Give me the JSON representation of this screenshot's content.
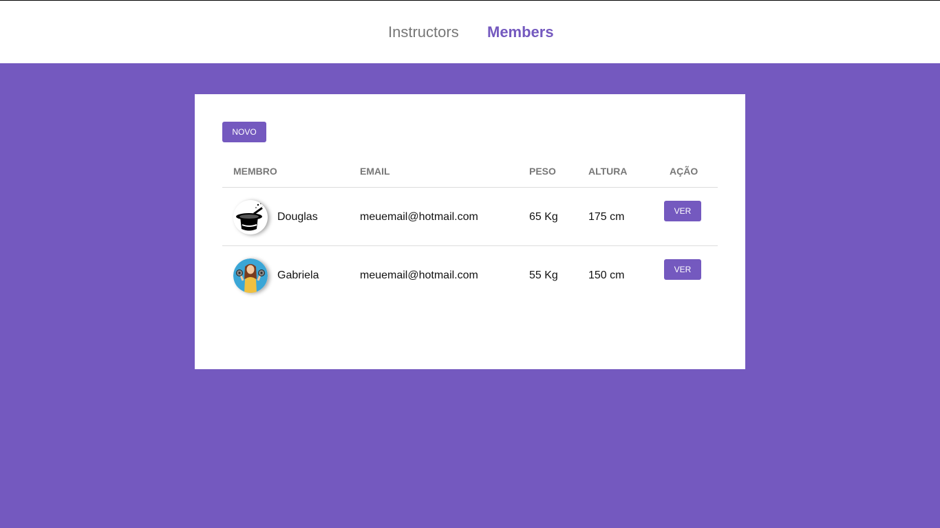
{
  "nav": {
    "instructors_label": "Instructors",
    "members_label": "Members",
    "active": "Members"
  },
  "toolbar": {
    "new_label": "NOVO"
  },
  "table": {
    "headers": {
      "member": "MEMBRO",
      "email": "EMAIL",
      "weight": "PESO",
      "height": "ALTURA",
      "action": "AÇÃO"
    },
    "rows": [
      {
        "name": "Douglas",
        "email": "meuemail@hotmail.com",
        "weight": "65 Kg",
        "height": "175 cm",
        "action_label": "VER",
        "avatar_icon": "magic-hat-icon"
      },
      {
        "name": "Gabriela",
        "email": "meuemail@hotmail.com",
        "weight": "55 Kg",
        "height": "150 cm",
        "action_label": "VER",
        "avatar_icon": "woman-with-dumbbells-icon"
      }
    ]
  },
  "colors": {
    "accent": "#7459bf",
    "background": "#7459bf",
    "muted_text": "#777777"
  }
}
